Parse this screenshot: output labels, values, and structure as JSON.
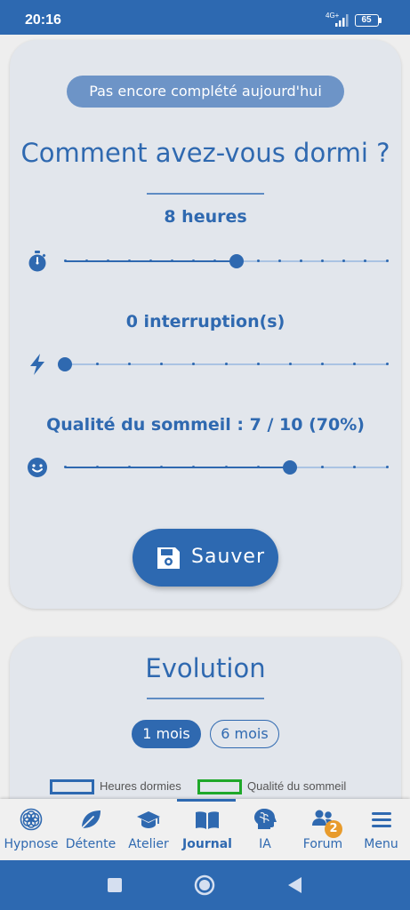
{
  "status_bar": {
    "time": "20:16",
    "network": "4G+",
    "battery": "65"
  },
  "sleep_form": {
    "status_pill": "Pas encore complété aujourd'hui",
    "title": "Comment avez-vous dormi ?",
    "hours": {
      "label": "8 heures",
      "value": 8,
      "min": 0,
      "max": 15
    },
    "interruptions": {
      "label": "0 interruption(s)",
      "value": 0,
      "min": 0,
      "max": 10
    },
    "quality": {
      "label": "Qualité du sommeil : 7 / 10 (70%)",
      "value": 7,
      "min": 0,
      "max": 10
    },
    "save_label": "Sauver"
  },
  "evolution": {
    "title": "Evolution",
    "ranges": [
      {
        "label": "1 mois",
        "selected": true
      },
      {
        "label": "6 mois",
        "selected": false
      }
    ],
    "legend": [
      {
        "label": "Heures dormies",
        "color": "#2d69b1"
      },
      {
        "label": "Qualité du sommeil",
        "color": "#1fa82a"
      }
    ]
  },
  "tabs": [
    {
      "label": "Hypnose",
      "icon": "flower-of-life-icon"
    },
    {
      "label": "Détente",
      "icon": "leaf-icon"
    },
    {
      "label": "Atelier",
      "icon": "graduation-cap-icon"
    },
    {
      "label": "Journal",
      "icon": "open-book-icon",
      "active": true
    },
    {
      "label": "IA",
      "icon": "brain-head-icon"
    },
    {
      "label": "Forum",
      "icon": "users-icon",
      "badge": "2"
    },
    {
      "label": "Menu",
      "icon": "hamburger-menu-icon"
    }
  ],
  "colors": {
    "primary": "#2d69b1",
    "background": "#eeeeee",
    "card": "#e2e6ec",
    "badge": "#e89b2c",
    "quality_legend": "#1fa82a"
  }
}
